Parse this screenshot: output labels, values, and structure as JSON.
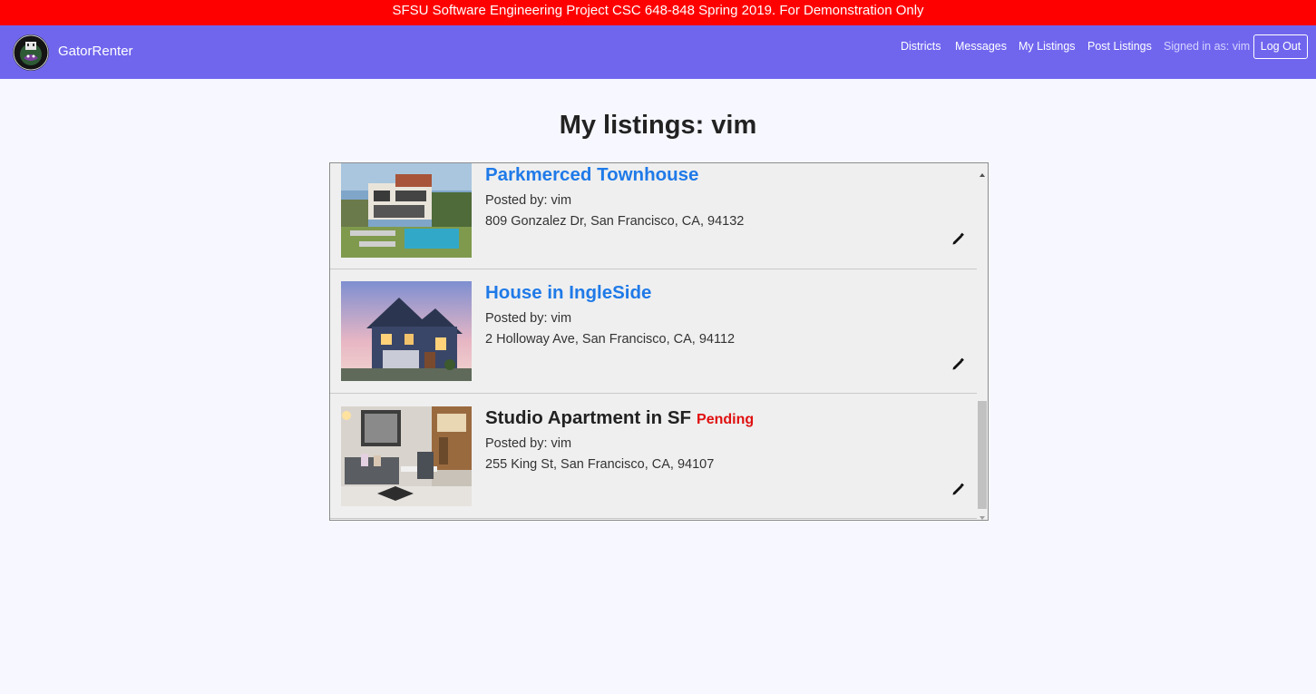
{
  "banner": {
    "text": "SFSU Software Engineering Project CSC 648-848 Spring 2019. For Demonstration Only"
  },
  "navbar": {
    "brand": "GatorRenter",
    "links": [
      {
        "label": "Districts"
      },
      {
        "label": "Messages"
      },
      {
        "label": "My Listings"
      },
      {
        "label": "Post Listings"
      }
    ],
    "signed_in": "Signed in as: vim",
    "logout_label": "Log Out"
  },
  "page": {
    "title": "My listings: vim"
  },
  "listings": [
    {
      "title": "Parkmerced Townhouse",
      "posted_by": "Posted by: vim",
      "address": "809 Gonzalez Dr, San Francisco, CA, 94132",
      "status": ""
    },
    {
      "title": "House in IngleSide",
      "posted_by": "Posted by: vim",
      "address": "2 Holloway Ave, San Francisco, CA, 94112",
      "status": ""
    },
    {
      "title": "Studio Apartment in SF",
      "posted_by": "Posted by: vim",
      "address": "255 King St, San Francisco, CA, 94107",
      "status": "Pending"
    }
  ],
  "colors": {
    "banner": "#ff0000",
    "navbar": "#7066ee",
    "link_title": "#1f7ae8",
    "pending": "#e01010"
  },
  "icons": [
    "logo-icon",
    "edit-pencil-icon",
    "scroll-up-icon",
    "scroll-down-icon"
  ]
}
